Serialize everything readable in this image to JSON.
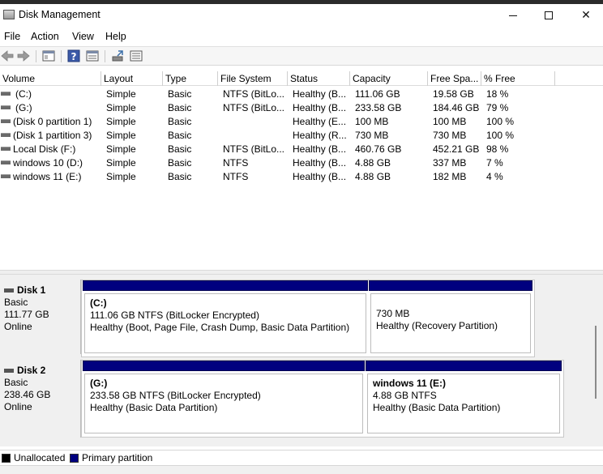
{
  "window": {
    "title": "Disk Management"
  },
  "menu": [
    "File",
    "Action",
    "View",
    "Help"
  ],
  "columns": [
    "Volume",
    "Layout",
    "Type",
    "File System",
    "Status",
    "Capacity",
    "Free Spa...",
    "% Free"
  ],
  "volumes": [
    {
      "volume": "(C:)",
      "layout": "Simple",
      "type": "Basic",
      "fs": "NTFS (BitLo...",
      "status": "Healthy (B...",
      "capacity": "111.06 GB",
      "free": "19.58 GB",
      "pct": "18 %"
    },
    {
      "volume": "(G:)",
      "layout": "Simple",
      "type": "Basic",
      "fs": "NTFS (BitLo...",
      "status": "Healthy (B...",
      "capacity": "233.58 GB",
      "free": "184.46 GB",
      "pct": "79 %"
    },
    {
      "volume": "(Disk 0 partition 1)",
      "layout": "Simple",
      "type": "Basic",
      "fs": "",
      "status": "Healthy (E...",
      "capacity": "100 MB",
      "free": "100 MB",
      "pct": "100 %"
    },
    {
      "volume": "(Disk 1 partition 3)",
      "layout": "Simple",
      "type": "Basic",
      "fs": "",
      "status": "Healthy (R...",
      "capacity": "730 MB",
      "free": "730 MB",
      "pct": "100 %"
    },
    {
      "volume": "Local Disk (F:)",
      "layout": "Simple",
      "type": "Basic",
      "fs": "NTFS (BitLo...",
      "status": "Healthy (B...",
      "capacity": "460.76 GB",
      "free": "452.21 GB",
      "pct": "98 %"
    },
    {
      "volume": "windows 10 (D:)",
      "layout": "Simple",
      "type": "Basic",
      "fs": "NTFS",
      "status": "Healthy (B...",
      "capacity": "4.88 GB",
      "free": "337 MB",
      "pct": "7 %"
    },
    {
      "volume": "windows 11 (E:)",
      "layout": "Simple",
      "type": "Basic",
      "fs": "NTFS",
      "status": "Healthy (B...",
      "capacity": "4.88 GB",
      "free": "182 MB",
      "pct": "4 %"
    }
  ],
  "disks": [
    {
      "name": "Disk 1",
      "type": "Basic",
      "size": "111.77 GB",
      "state": "Online",
      "partitions": [
        {
          "name": "(C:)",
          "size": "111.06 GB NTFS (BitLocker Encrypted)",
          "status": "Healthy (Boot, Page File, Crash Dump, Basic Data Partition)"
        },
        {
          "name": "",
          "size": "730 MB",
          "status": "Healthy (Recovery Partition)"
        }
      ]
    },
    {
      "name": "Disk 2",
      "type": "Basic",
      "size": "238.46 GB",
      "state": "Online",
      "partitions": [
        {
          "name": "(G:)",
          "size": "233.58 GB NTFS (BitLocker Encrypted)",
          "status": "Healthy (Basic Data Partition)"
        },
        {
          "name": "windows 11  (E:)",
          "size": "4.88 GB NTFS",
          "status": "Healthy (Basic Data Partition)"
        }
      ]
    }
  ],
  "legend": [
    {
      "label": "Unallocated",
      "color": "#000000"
    },
    {
      "label": "Primary partition",
      "color": "#00007f"
    }
  ]
}
